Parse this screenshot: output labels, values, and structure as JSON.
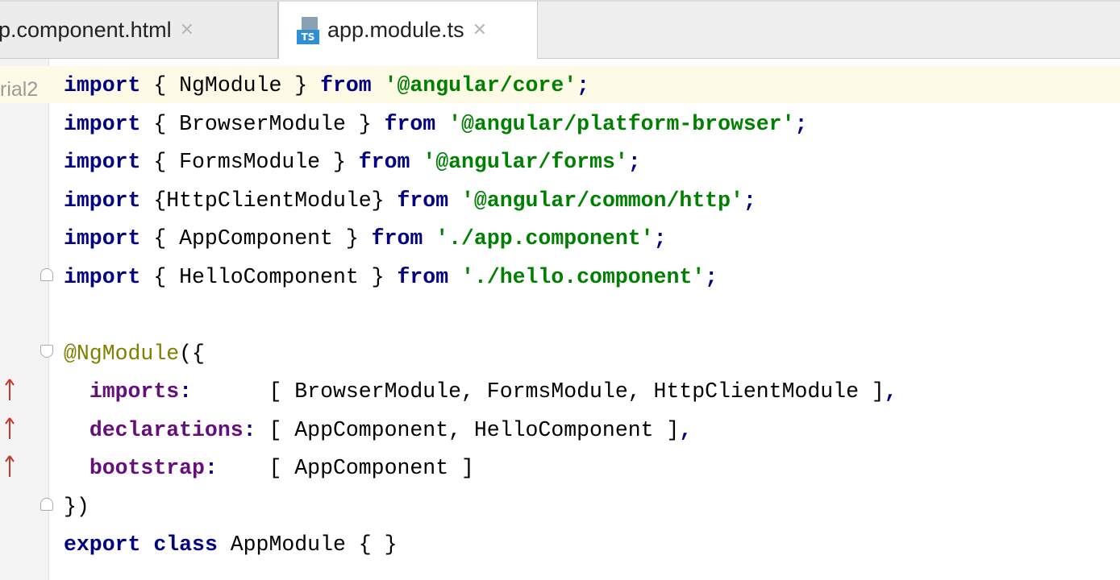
{
  "tabs": [
    {
      "label": "p.component.html",
      "active": false
    },
    {
      "label": "app.module.ts",
      "active": true,
      "icon": "typescript-file-icon",
      "icon_text": "TS"
    }
  ],
  "breadcrumb": "rial2",
  "code_lines": [
    [
      {
        "t": "import",
        "c": "kw"
      },
      {
        "t": " { NgModule } ",
        "c": ""
      },
      {
        "t": "from",
        "c": "kw"
      },
      {
        "t": " ",
        "c": ""
      },
      {
        "t": "'@angular/core'",
        "c": "str"
      },
      {
        "t": ";",
        "c": "kw"
      }
    ],
    [
      {
        "t": "import",
        "c": "kw"
      },
      {
        "t": " { BrowserModule } ",
        "c": ""
      },
      {
        "t": "from",
        "c": "kw"
      },
      {
        "t": " ",
        "c": ""
      },
      {
        "t": "'@angular/platform-browser'",
        "c": "str"
      },
      {
        "t": ";",
        "c": "kw"
      }
    ],
    [
      {
        "t": "import",
        "c": "kw"
      },
      {
        "t": " { FormsModule } ",
        "c": ""
      },
      {
        "t": "from",
        "c": "kw"
      },
      {
        "t": " ",
        "c": ""
      },
      {
        "t": "'@angular/forms'",
        "c": "str"
      },
      {
        "t": ";",
        "c": "kw"
      }
    ],
    [
      {
        "t": "import",
        "c": "kw"
      },
      {
        "t": " {HttpClientModule} ",
        "c": ""
      },
      {
        "t": "from",
        "c": "kw"
      },
      {
        "t": " ",
        "c": ""
      },
      {
        "t": "'@angular/common/http'",
        "c": "str"
      },
      {
        "t": ";",
        "c": "kw"
      }
    ],
    [
      {
        "t": "import",
        "c": "kw"
      },
      {
        "t": " { AppComponent } ",
        "c": ""
      },
      {
        "t": "from",
        "c": "kw"
      },
      {
        "t": " ",
        "c": ""
      },
      {
        "t": "'./app.component'",
        "c": "str"
      },
      {
        "t": ";",
        "c": "kw"
      }
    ],
    [
      {
        "t": "import",
        "c": "kw"
      },
      {
        "t": " { HelloComponent } ",
        "c": ""
      },
      {
        "t": "from",
        "c": "kw"
      },
      {
        "t": " ",
        "c": ""
      },
      {
        "t": "'./hello.component'",
        "c": "str"
      },
      {
        "t": ";",
        "c": "kw"
      }
    ],
    [],
    [
      {
        "t": "@NgModule",
        "c": "dec"
      },
      {
        "t": "({",
        "c": ""
      }
    ],
    [
      {
        "t": "  ",
        "c": ""
      },
      {
        "t": "imports",
        "c": "prop"
      },
      {
        "t": ":",
        "c": "kw"
      },
      {
        "t": "      [ BrowserModule, FormsModule, HttpClientModule ]",
        "c": ""
      },
      {
        "t": ",",
        "c": "kw"
      }
    ],
    [
      {
        "t": "  ",
        "c": ""
      },
      {
        "t": "declarations",
        "c": "prop"
      },
      {
        "t": ":",
        "c": "kw"
      },
      {
        "t": " [ AppComponent, HelloComponent ]",
        "c": ""
      },
      {
        "t": ",",
        "c": "kw"
      }
    ],
    [
      {
        "t": "  ",
        "c": ""
      },
      {
        "t": "bootstrap",
        "c": "prop"
      },
      {
        "t": ":",
        "c": "kw"
      },
      {
        "t": "    [ AppComponent ]",
        "c": ""
      }
    ],
    [
      {
        "t": "})",
        "c": ""
      }
    ],
    [
      {
        "t": "export",
        "c": "kw"
      },
      {
        "t": " ",
        "c": ""
      },
      {
        "t": "class",
        "c": "kw"
      },
      {
        "t": " AppModule { }",
        "c": ""
      }
    ]
  ],
  "current_line": 0,
  "fold_markers": [
    {
      "line": 5,
      "type": "up"
    },
    {
      "line": 7,
      "type": "down"
    },
    {
      "line": 11,
      "type": "up"
    }
  ],
  "gutter_arrows": [
    8,
    9,
    10
  ],
  "colors": {
    "keyword": "#000080",
    "string": "#008000",
    "decorator": "#808000",
    "property": "#660e7a",
    "current_line_bg": "#fdfae6",
    "gutter_arrow": "#c0392b"
  }
}
